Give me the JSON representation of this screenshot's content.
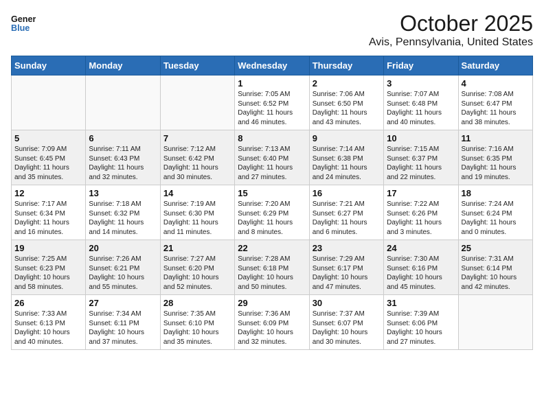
{
  "header": {
    "logo_line1": "General",
    "logo_line2": "Blue",
    "month_title": "October 2025",
    "location": "Avis, Pennsylvania, United States"
  },
  "weekdays": [
    "Sunday",
    "Monday",
    "Tuesday",
    "Wednesday",
    "Thursday",
    "Friday",
    "Saturday"
  ],
  "weeks": [
    [
      {
        "day": "",
        "info": ""
      },
      {
        "day": "",
        "info": ""
      },
      {
        "day": "",
        "info": ""
      },
      {
        "day": "1",
        "info": "Sunrise: 7:05 AM\nSunset: 6:52 PM\nDaylight: 11 hours\nand 46 minutes."
      },
      {
        "day": "2",
        "info": "Sunrise: 7:06 AM\nSunset: 6:50 PM\nDaylight: 11 hours\nand 43 minutes."
      },
      {
        "day": "3",
        "info": "Sunrise: 7:07 AM\nSunset: 6:48 PM\nDaylight: 11 hours\nand 40 minutes."
      },
      {
        "day": "4",
        "info": "Sunrise: 7:08 AM\nSunset: 6:47 PM\nDaylight: 11 hours\nand 38 minutes."
      }
    ],
    [
      {
        "day": "5",
        "info": "Sunrise: 7:09 AM\nSunset: 6:45 PM\nDaylight: 11 hours\nand 35 minutes."
      },
      {
        "day": "6",
        "info": "Sunrise: 7:11 AM\nSunset: 6:43 PM\nDaylight: 11 hours\nand 32 minutes."
      },
      {
        "day": "7",
        "info": "Sunrise: 7:12 AM\nSunset: 6:42 PM\nDaylight: 11 hours\nand 30 minutes."
      },
      {
        "day": "8",
        "info": "Sunrise: 7:13 AM\nSunset: 6:40 PM\nDaylight: 11 hours\nand 27 minutes."
      },
      {
        "day": "9",
        "info": "Sunrise: 7:14 AM\nSunset: 6:38 PM\nDaylight: 11 hours\nand 24 minutes."
      },
      {
        "day": "10",
        "info": "Sunrise: 7:15 AM\nSunset: 6:37 PM\nDaylight: 11 hours\nand 22 minutes."
      },
      {
        "day": "11",
        "info": "Sunrise: 7:16 AM\nSunset: 6:35 PM\nDaylight: 11 hours\nand 19 minutes."
      }
    ],
    [
      {
        "day": "12",
        "info": "Sunrise: 7:17 AM\nSunset: 6:34 PM\nDaylight: 11 hours\nand 16 minutes."
      },
      {
        "day": "13",
        "info": "Sunrise: 7:18 AM\nSunset: 6:32 PM\nDaylight: 11 hours\nand 14 minutes."
      },
      {
        "day": "14",
        "info": "Sunrise: 7:19 AM\nSunset: 6:30 PM\nDaylight: 11 hours\nand 11 minutes."
      },
      {
        "day": "15",
        "info": "Sunrise: 7:20 AM\nSunset: 6:29 PM\nDaylight: 11 hours\nand 8 minutes."
      },
      {
        "day": "16",
        "info": "Sunrise: 7:21 AM\nSunset: 6:27 PM\nDaylight: 11 hours\nand 6 minutes."
      },
      {
        "day": "17",
        "info": "Sunrise: 7:22 AM\nSunset: 6:26 PM\nDaylight: 11 hours\nand 3 minutes."
      },
      {
        "day": "18",
        "info": "Sunrise: 7:24 AM\nSunset: 6:24 PM\nDaylight: 11 hours\nand 0 minutes."
      }
    ],
    [
      {
        "day": "19",
        "info": "Sunrise: 7:25 AM\nSunset: 6:23 PM\nDaylight: 10 hours\nand 58 minutes."
      },
      {
        "day": "20",
        "info": "Sunrise: 7:26 AM\nSunset: 6:21 PM\nDaylight: 10 hours\nand 55 minutes."
      },
      {
        "day": "21",
        "info": "Sunrise: 7:27 AM\nSunset: 6:20 PM\nDaylight: 10 hours\nand 52 minutes."
      },
      {
        "day": "22",
        "info": "Sunrise: 7:28 AM\nSunset: 6:18 PM\nDaylight: 10 hours\nand 50 minutes."
      },
      {
        "day": "23",
        "info": "Sunrise: 7:29 AM\nSunset: 6:17 PM\nDaylight: 10 hours\nand 47 minutes."
      },
      {
        "day": "24",
        "info": "Sunrise: 7:30 AM\nSunset: 6:16 PM\nDaylight: 10 hours\nand 45 minutes."
      },
      {
        "day": "25",
        "info": "Sunrise: 7:31 AM\nSunset: 6:14 PM\nDaylight: 10 hours\nand 42 minutes."
      }
    ],
    [
      {
        "day": "26",
        "info": "Sunrise: 7:33 AM\nSunset: 6:13 PM\nDaylight: 10 hours\nand 40 minutes."
      },
      {
        "day": "27",
        "info": "Sunrise: 7:34 AM\nSunset: 6:11 PM\nDaylight: 10 hours\nand 37 minutes."
      },
      {
        "day": "28",
        "info": "Sunrise: 7:35 AM\nSunset: 6:10 PM\nDaylight: 10 hours\nand 35 minutes."
      },
      {
        "day": "29",
        "info": "Sunrise: 7:36 AM\nSunset: 6:09 PM\nDaylight: 10 hours\nand 32 minutes."
      },
      {
        "day": "30",
        "info": "Sunrise: 7:37 AM\nSunset: 6:07 PM\nDaylight: 10 hours\nand 30 minutes."
      },
      {
        "day": "31",
        "info": "Sunrise: 7:39 AM\nSunset: 6:06 PM\nDaylight: 10 hours\nand 27 minutes."
      },
      {
        "day": "",
        "info": ""
      }
    ]
  ]
}
